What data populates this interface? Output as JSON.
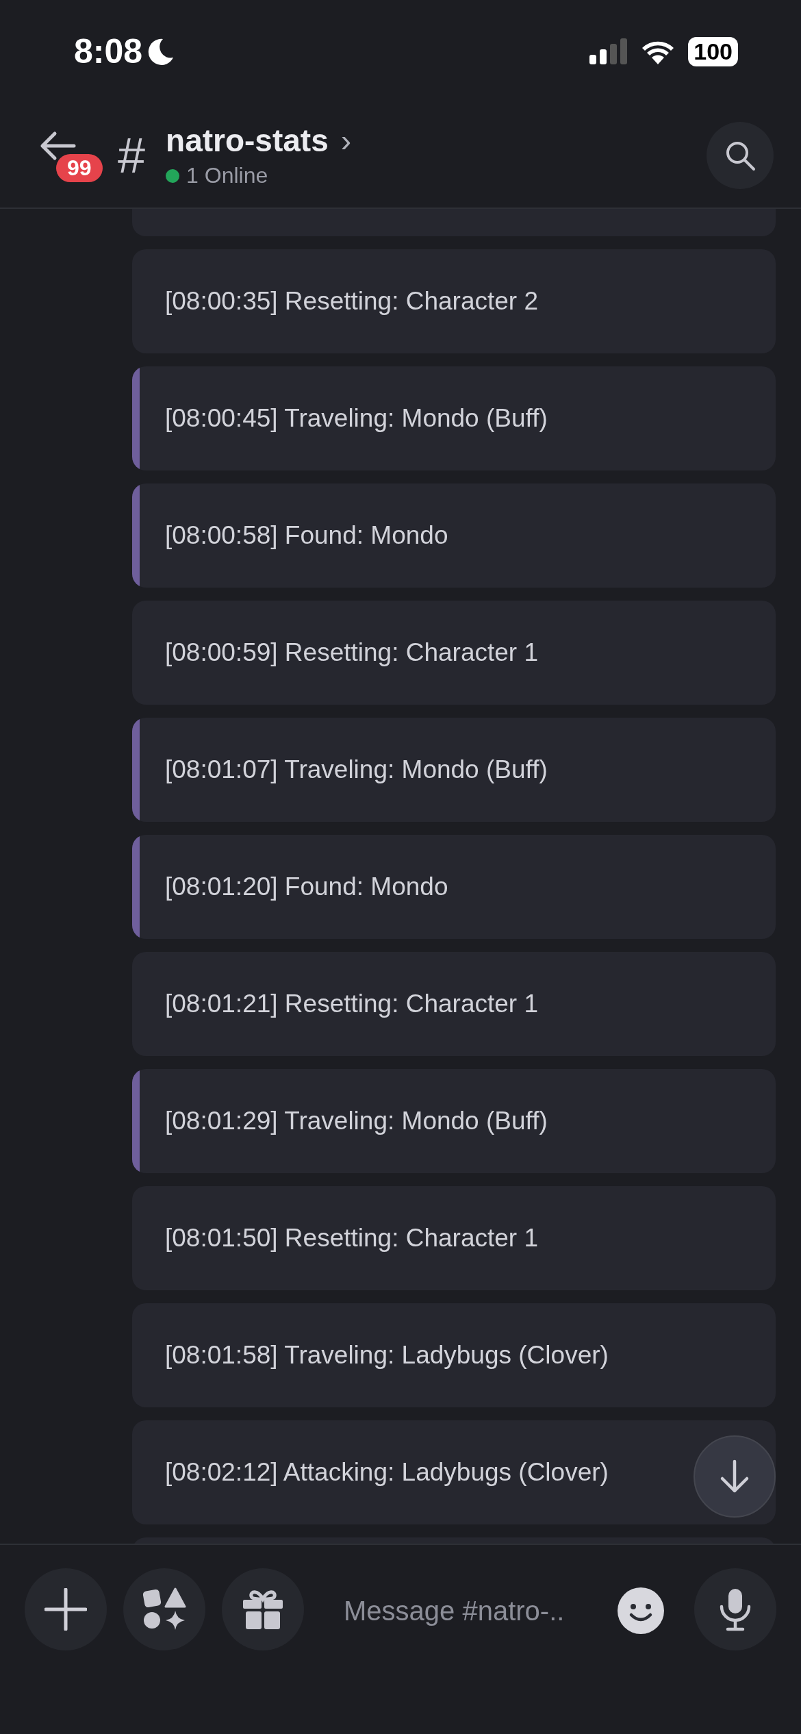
{
  "status_bar": {
    "time": "8:08",
    "focus_mode": true,
    "battery": "100"
  },
  "header": {
    "back_badge": "99",
    "channel_symbol": "#",
    "channel": "natro-stats",
    "chevron": "›",
    "online": "1 Online"
  },
  "messages": [
    {
      "text": "[08:00:35] Resetting: Character 2",
      "accent": false
    },
    {
      "text": "[08:00:45] Traveling: Mondo (Buff)",
      "accent": true
    },
    {
      "text": "[08:00:58] Found: Mondo",
      "accent": true
    },
    {
      "text": "[08:00:59] Resetting: Character 1",
      "accent": false
    },
    {
      "text": "[08:01:07] Traveling: Mondo (Buff)",
      "accent": true
    },
    {
      "text": "[08:01:20] Found: Mondo",
      "accent": true
    },
    {
      "text": "[08:01:21] Resetting: Character 1",
      "accent": false
    },
    {
      "text": "[08:01:29] Traveling: Mondo (Buff)",
      "accent": true
    },
    {
      "text": "[08:01:50] Resetting: Character 1",
      "accent": false
    },
    {
      "text": "[08:01:58] Traveling: Ladybugs (Clover)",
      "accent": false
    },
    {
      "text": "[08:02:12] Attacking: Ladybugs (Clover)",
      "accent": false
    }
  ],
  "composer": {
    "placeholder": "Message #natro-.."
  }
}
